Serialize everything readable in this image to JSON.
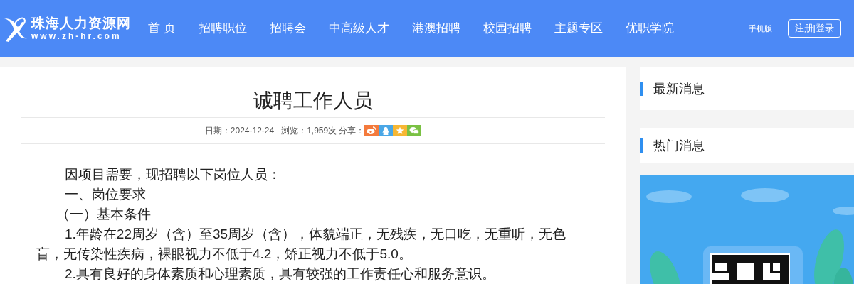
{
  "header": {
    "logo": {
      "name": "珠海人力资源网",
      "url": "www.zh-hr.com"
    },
    "nav": [
      {
        "label": "首 页"
      },
      {
        "label": "招聘职位"
      },
      {
        "label": "招聘会"
      },
      {
        "label": "中高级人才"
      },
      {
        "label": "港澳招聘"
      },
      {
        "label": "校园招聘"
      },
      {
        "label": "主题专区"
      },
      {
        "label": "优职学院"
      }
    ],
    "mobile_link": "手机版",
    "login_button": "注册|登录"
  },
  "article": {
    "title": "诚聘工作人员",
    "date": "日期：2024-12-24",
    "views": "浏览：1,959次",
    "share_label": "分享：",
    "share": [
      {
        "kind": "weibo",
        "color": "#f47a3c"
      },
      {
        "kind": "qq",
        "color": "#4aa7e6"
      },
      {
        "kind": "star",
        "color": "#f7b733"
      },
      {
        "kind": "wechat",
        "color": "#7ac143"
      }
    ],
    "paragraphs": [
      {
        "kind": "indent",
        "text": "因项目需要，现招聘以下岗位人员："
      },
      {
        "kind": "indent",
        "text": "一、岗位要求"
      },
      {
        "kind": "plain",
        "text": "（一）基本条件"
      },
      {
        "kind": "indent",
        "text": "1.年龄在22周岁（含）至35周岁（含），体貌端正，无残疾，无口吃，无重听，无色盲，无传染性疾病，裸眼视力不低于4.2，矫正视力不低于5.0。"
      },
      {
        "kind": "indent",
        "text": "2.具有良好的身体素质和心理素质，具有较强的工作责任心和服务意识。"
      }
    ]
  },
  "sidebar": {
    "sections": [
      {
        "title": "最新消息"
      },
      {
        "title": "热门消息"
      }
    ]
  }
}
